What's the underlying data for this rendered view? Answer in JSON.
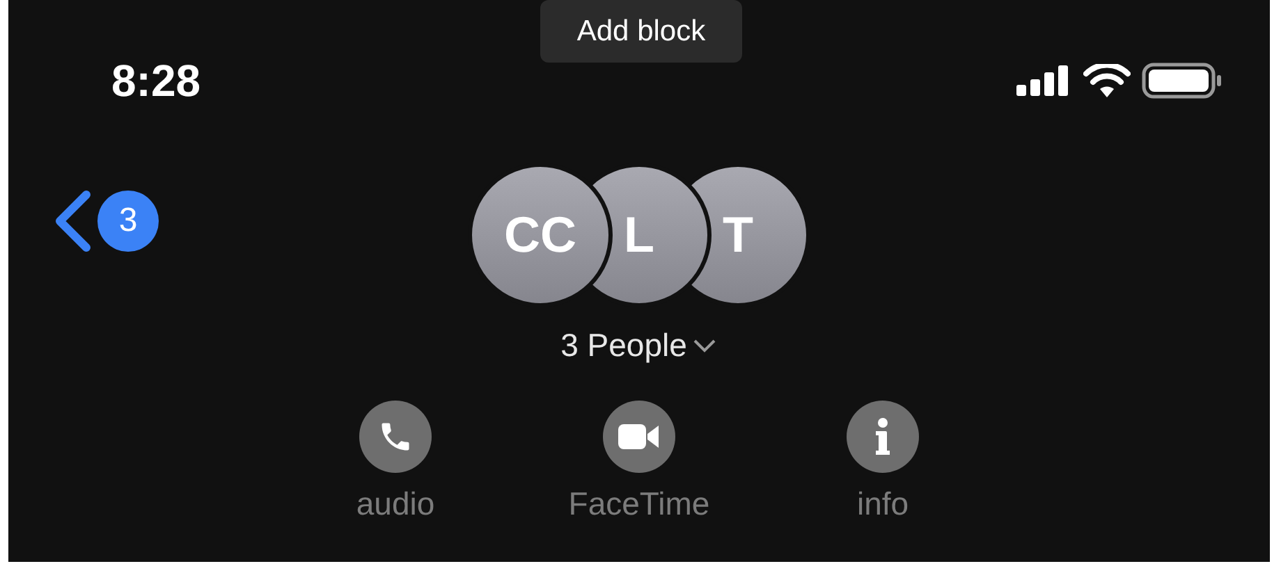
{
  "tooltip": {
    "text": "Add block"
  },
  "status_bar": {
    "time": "8:28"
  },
  "back": {
    "count": "3"
  },
  "avatars": [
    {
      "initials": "CC"
    },
    {
      "initials": "L"
    },
    {
      "initials": "T"
    }
  ],
  "title": "3 People",
  "actions": [
    {
      "kind": "audio",
      "label": "audio"
    },
    {
      "kind": "video",
      "label": "FaceTime"
    },
    {
      "kind": "info",
      "label": "info"
    }
  ]
}
